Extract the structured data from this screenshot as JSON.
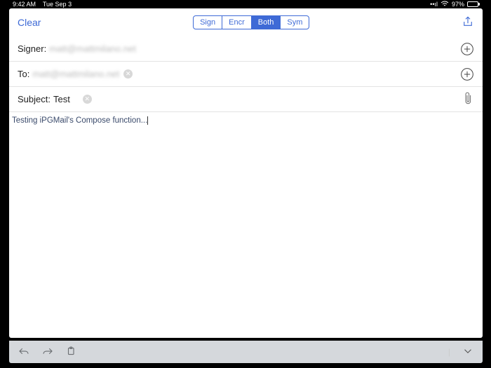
{
  "status": {
    "time": "9:42 AM",
    "date": "Tue Sep 3",
    "battery_pct": "97%"
  },
  "header": {
    "clear_label": "Clear",
    "segments": {
      "sign": "Sign",
      "encr": "Encr",
      "both": "Both",
      "sym": "Sym"
    },
    "active_segment": "both"
  },
  "fields": {
    "signer_label": "Signer:",
    "signer_value": "matt@mattmilano.net",
    "to_label": "To:",
    "to_value": "matt@mattmilano.net",
    "subject_label": "Subject:",
    "subject_value": "Test"
  },
  "body": {
    "text": "Testing iPGMail's Compose function..."
  }
}
